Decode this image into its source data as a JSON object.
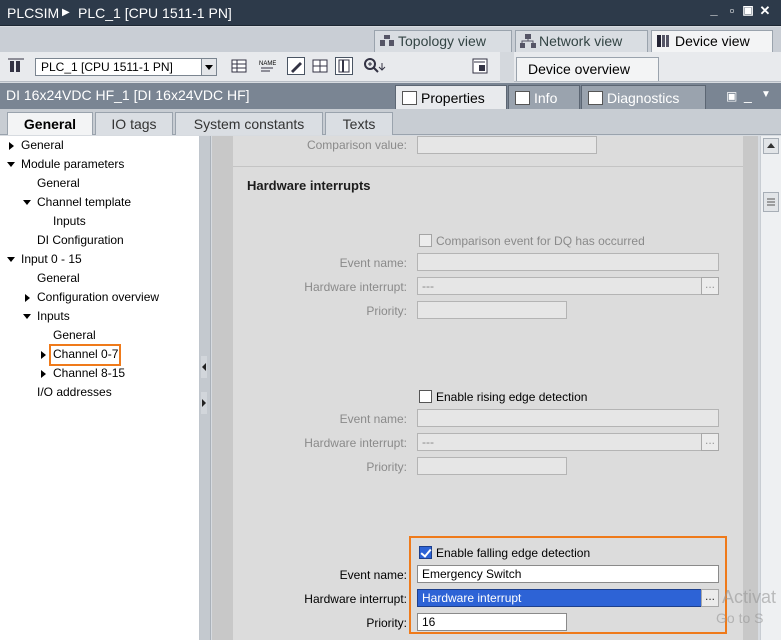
{
  "titlebar": {
    "app": "PLCSIM",
    "device": "PLC_1 [CPU 1511-1 PN]"
  },
  "views": {
    "topology": "Topology view",
    "network": "Network view",
    "device": "Device view"
  },
  "toolbar": {
    "device_select": "PLC_1 [CPU 1511-1 PN]",
    "device_overview": "Device overview"
  },
  "module": {
    "title": "DI 16x24VDC HF_1 [DI 16x24VDC HF]",
    "tabs": {
      "properties": "Properties",
      "info": "Info",
      "diagnostics": "Diagnostics"
    }
  },
  "subtabs": [
    "General",
    "IO tags",
    "System constants",
    "Texts"
  ],
  "tree": {
    "items": [
      {
        "label": "General"
      },
      {
        "label": "Module parameters"
      },
      {
        "label": "General"
      },
      {
        "label": "Channel template"
      },
      {
        "label": "Inputs"
      },
      {
        "label": "DI Configuration"
      },
      {
        "label": "Input 0 - 15"
      },
      {
        "label": "General"
      },
      {
        "label": "Configuration overview"
      },
      {
        "label": "Inputs"
      },
      {
        "label": "General"
      },
      {
        "label": "Channel 0-7"
      },
      {
        "label": "Channel 8-15"
      },
      {
        "label": "I/O addresses"
      }
    ]
  },
  "content": {
    "comparison_value_label": "Comparison value:",
    "section_title": "Hardware interrupts",
    "group1": {
      "checkbox_label": "Comparison event for DQ has occurred",
      "event_name_label": "Event name:",
      "hw_interrupt_label": "Hardware interrupt:",
      "hw_interrupt_value": "---",
      "priority_label": "Priority:"
    },
    "group2": {
      "checkbox_label": "Enable rising edge detection",
      "event_name_label": "Event name:",
      "hw_interrupt_label": "Hardware interrupt:",
      "hw_interrupt_value": "---",
      "priority_label": "Priority:"
    },
    "group3": {
      "checkbox_label": "Enable falling edge detection",
      "checked": true,
      "event_name_label": "Event name:",
      "event_name_value": "Emergency Switch",
      "hw_interrupt_label": "Hardware interrupt:",
      "hw_interrupt_value": "Hardware interrupt",
      "priority_label": "Priority:",
      "priority_value": "16"
    },
    "browse_button": "..."
  },
  "watermark": {
    "line1": "Activat",
    "line2": "Go to S"
  },
  "colors": {
    "highlight": "#ef7a1a",
    "selection": "#2d63d6",
    "titlebar": "#2d3a4a"
  }
}
